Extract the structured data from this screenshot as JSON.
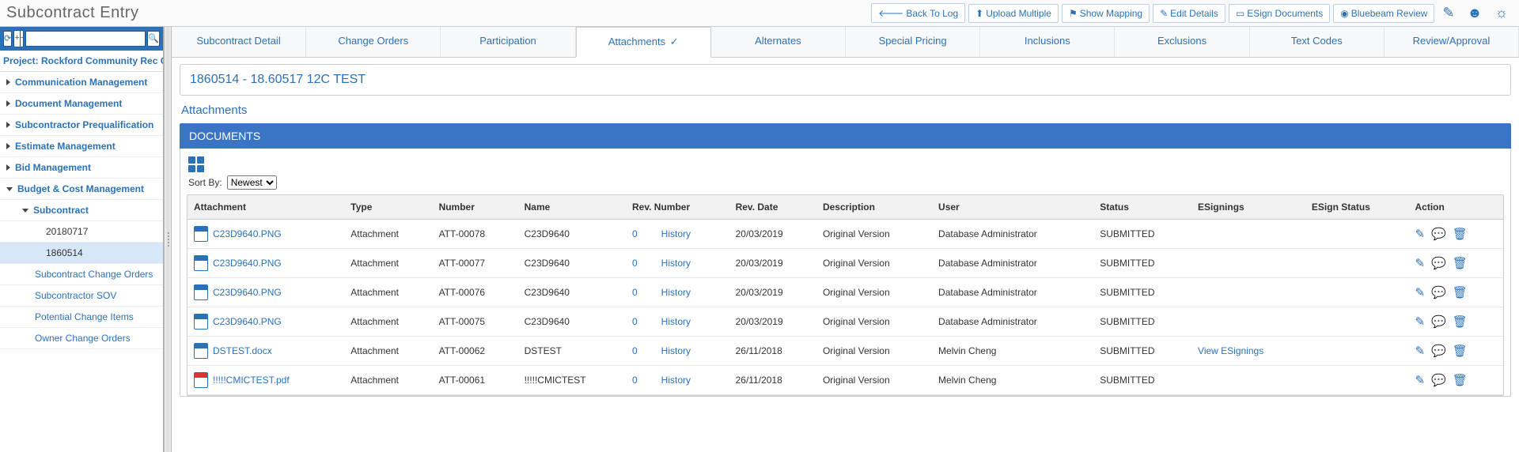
{
  "header": {
    "title": "Subcontract Entry",
    "buttons": {
      "back": "Back To Log",
      "upload": "Upload Multiple",
      "mapping": "Show Mapping",
      "edit": "Edit Details",
      "esign": "ESign Documents",
      "bluebeam": "Bluebeam Review"
    }
  },
  "sidebar": {
    "project": "Project: Rockford Community Rec Cen",
    "items": [
      "Communication Management",
      "Document Management",
      "Subcontractor Prequalification",
      "Estimate Management",
      "Bid Management"
    ],
    "budget": "Budget & Cost Management",
    "subcontract": "Subcontract",
    "leaves": [
      "20180717",
      "1860514"
    ],
    "subitems": [
      "Subcontract Change Orders",
      "Subcontractor SOV",
      "Potential Change Items",
      "Owner Change Orders"
    ]
  },
  "tabs": [
    "Subcontract Detail",
    "Change Orders",
    "Participation",
    "Attachments",
    "Alternates",
    "Special Pricing",
    "Inclusions",
    "Exclusions",
    "Text Codes",
    "Review/Approval"
  ],
  "subc_title": "1860514 - 18.60517 12C TEST",
  "section": "Attachments",
  "doc_header": "DOCUMENTS",
  "sort_label": "Sort By:",
  "sort_value": "Newest",
  "cols": {
    "attachment": "Attachment",
    "type": "Type",
    "number": "Number",
    "name": "Name",
    "rev_number": "Rev. Number",
    "rev_date": "Rev. Date",
    "description": "Description",
    "user": "User",
    "status": "Status",
    "esignings": "ESignings",
    "esign_status": "ESign Status",
    "action": "Action"
  },
  "rows": [
    {
      "file": "C23D9640.PNG",
      "type": "Attachment",
      "number": "ATT-00078",
      "name": "C23D9640",
      "rev": "0",
      "hist": "History",
      "date": "20/03/2019",
      "desc": "Original Version",
      "user": "Database Administrator",
      "status": "SUBMITTED",
      "esign": "",
      "icon": "png"
    },
    {
      "file": "C23D9640.PNG",
      "type": "Attachment",
      "number": "ATT-00077",
      "name": "C23D9640",
      "rev": "0",
      "hist": "History",
      "date": "20/03/2019",
      "desc": "Original Version",
      "user": "Database Administrator",
      "status": "SUBMITTED",
      "esign": "",
      "icon": "png"
    },
    {
      "file": "C23D9640.PNG",
      "type": "Attachment",
      "number": "ATT-00076",
      "name": "C23D9640",
      "rev": "0",
      "hist": "History",
      "date": "20/03/2019",
      "desc": "Original Version",
      "user": "Database Administrator",
      "status": "SUBMITTED",
      "esign": "",
      "icon": "png"
    },
    {
      "file": "C23D9640.PNG",
      "type": "Attachment",
      "number": "ATT-00075",
      "name": "C23D9640",
      "rev": "0",
      "hist": "History",
      "date": "20/03/2019",
      "desc": "Original Version",
      "user": "Database Administrator",
      "status": "SUBMITTED",
      "esign": "",
      "icon": "png"
    },
    {
      "file": "DSTEST.docx",
      "type": "Attachment",
      "number": "ATT-00062",
      "name": "DSTEST",
      "rev": "0",
      "hist": "History",
      "date": "26/11/2018",
      "desc": "Original Version",
      "user": "Melvin Cheng",
      "status": "SUBMITTED",
      "esign": "View ESignings",
      "icon": "doc"
    },
    {
      "file": "!!!!!CMICTEST.pdf",
      "type": "Attachment",
      "number": "ATT-00061",
      "name": "!!!!!CMICTEST",
      "rev": "0",
      "hist": "History",
      "date": "26/11/2018",
      "desc": "Original Version",
      "user": "Melvin Cheng",
      "status": "SUBMITTED",
      "esign": "",
      "icon": "pdf"
    }
  ]
}
